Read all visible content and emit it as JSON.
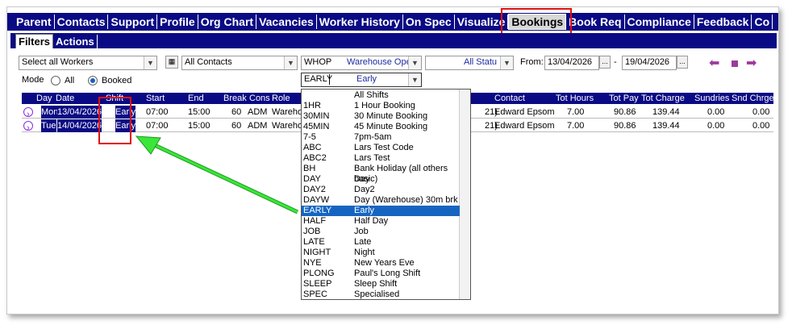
{
  "topnav": {
    "tabs": [
      "Parent",
      "Contacts",
      "Support",
      "Profile",
      "Org Chart",
      "Vacancies",
      "Worker History",
      "On Spec",
      "Visualize",
      "Bookings",
      "Book Req",
      "Compliance",
      "Feedback",
      "Co"
    ],
    "active": "Bookings"
  },
  "subnav": {
    "filters": "Filters",
    "actions": "Actions"
  },
  "filters": {
    "workers": "Select all Workers",
    "contacts": "All Contacts",
    "site_code": "WHOP",
    "site_name": "Warehouse Ope",
    "status": "All Statu",
    "from_label": "From:",
    "from_date": "13/04/2026",
    "dash": "-",
    "to_date": "19/04/2026",
    "ellipsis": "...",
    "mode_label": "Mode",
    "mode_all": "All",
    "mode_booked": "Booked",
    "shift_code": "EARLY",
    "shift_name": "Early"
  },
  "grid": {
    "headers": {
      "day": "Day",
      "date": "Date",
      "shift": "Shift",
      "start": "Start",
      "end": "End",
      "break": "Break",
      "cons": "Cons",
      "role": "Role",
      "contact": "Contact",
      "tot_hours": "Tot Hours",
      "tot_pay": "Tot Pay",
      "tot_charge": "Tot Charge",
      "sundries": "Sundries",
      "snd_chrge": "Snd Chrge"
    },
    "rows": [
      {
        "day": "Mon",
        "date": "13/04/2026",
        "shift": "Early",
        "start": "07:00",
        "end": "15:00",
        "break": "60",
        "cons": "ADM",
        "role": "Wareho",
        "role_tail": "21)",
        "contact": "Edward Epsom",
        "tot_hours": "7.00",
        "tot_pay": "90.86",
        "tot_charge": "139.44",
        "sundries": "0.00",
        "snd_chrge": "0.00"
      },
      {
        "day": "Tue",
        "date": "14/04/2026",
        "shift": "Early",
        "start": "07:00",
        "end": "15:00",
        "break": "60",
        "cons": "ADM",
        "role": "Wareho",
        "role_tail": "21)",
        "contact": "Edward Epsom",
        "tot_hours": "7.00",
        "tot_pay": "90.86",
        "tot_charge": "139.44",
        "sundries": "0.00",
        "snd_chrge": "0.00"
      }
    ]
  },
  "shift_options": [
    {
      "code": "",
      "name": "All Shifts"
    },
    {
      "code": "1HR",
      "name": "1 Hour Booking"
    },
    {
      "code": "30MIN",
      "name": "30 Minute Booking"
    },
    {
      "code": "45MIN",
      "name": "45 Minute Booking"
    },
    {
      "code": "7-5",
      "name": "7pm-5am"
    },
    {
      "code": "ABC",
      "name": "Lars Test Code"
    },
    {
      "code": "ABC2",
      "name": "Lars Test"
    },
    {
      "code": "BH",
      "name": "Bank Holiday (all others basic)"
    },
    {
      "code": "DAY",
      "name": "Day"
    },
    {
      "code": "DAY2",
      "name": "Day2"
    },
    {
      "code": "DAYW",
      "name": "Day (Warehouse) 30m brk"
    },
    {
      "code": "EARLY",
      "name": "Early"
    },
    {
      "code": "HALF",
      "name": "Half Day"
    },
    {
      "code": "JOB",
      "name": "Job"
    },
    {
      "code": "LATE",
      "name": "Late"
    },
    {
      "code": "NIGHT",
      "name": "Night"
    },
    {
      "code": "NYE",
      "name": "New Years Eve"
    },
    {
      "code": "PLONG",
      "name": "Paul's Long Shift"
    },
    {
      "code": "SLEEP",
      "name": "Sleep Shift"
    },
    {
      "code": "SPEC",
      "name": "Specialised"
    }
  ],
  "selected_shift": "EARLY",
  "colors": {
    "nav_bg": "#0a0a84",
    "highlight": "#e01010",
    "arrow": "#22cc22",
    "selection": "#1565c0"
  }
}
